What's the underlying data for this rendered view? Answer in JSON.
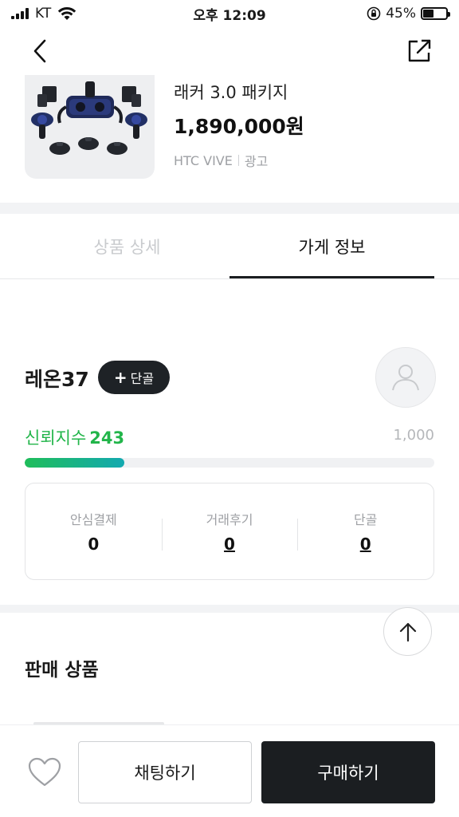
{
  "status_bar": {
    "carrier": "KT",
    "time": "오후 12:09",
    "battery_text": "45%",
    "battery_level": 0.45
  },
  "header": {
    "back_icon": "chevron-left-icon",
    "share_icon": "share-icon"
  },
  "product": {
    "title": "래커 3.0 패키지",
    "price": "1,890,000원",
    "brand": "HTC VIVE",
    "ad_label": "광고"
  },
  "tabs": {
    "items": [
      {
        "label": "상품 상세",
        "active": false
      },
      {
        "label": "가게 정보",
        "active": true
      }
    ]
  },
  "store": {
    "name": "레온37",
    "follow_plus": "+",
    "follow_label": "단골",
    "avatar_icon": "user-icon",
    "trust_label": "신뢰지수",
    "trust_value": "243",
    "trust_max": "1,000",
    "trust_fraction": 0.243,
    "trust_color": "#22b54a",
    "stats": [
      {
        "label": "안심결제",
        "value": "0",
        "link": false
      },
      {
        "label": "거래후기",
        "value": "0",
        "link": true
      },
      {
        "label": "단골",
        "value": "0",
        "link": true
      }
    ]
  },
  "products_section": {
    "title": "판매 상품"
  },
  "bottom_bar": {
    "heart_icon": "heart-icon",
    "chat_label": "채팅하기",
    "buy_label": "구매하기"
  },
  "scroll_top_icon": "arrow-up-icon",
  "colors": {
    "dark": "#1b1e21",
    "green": "#22b54a"
  }
}
